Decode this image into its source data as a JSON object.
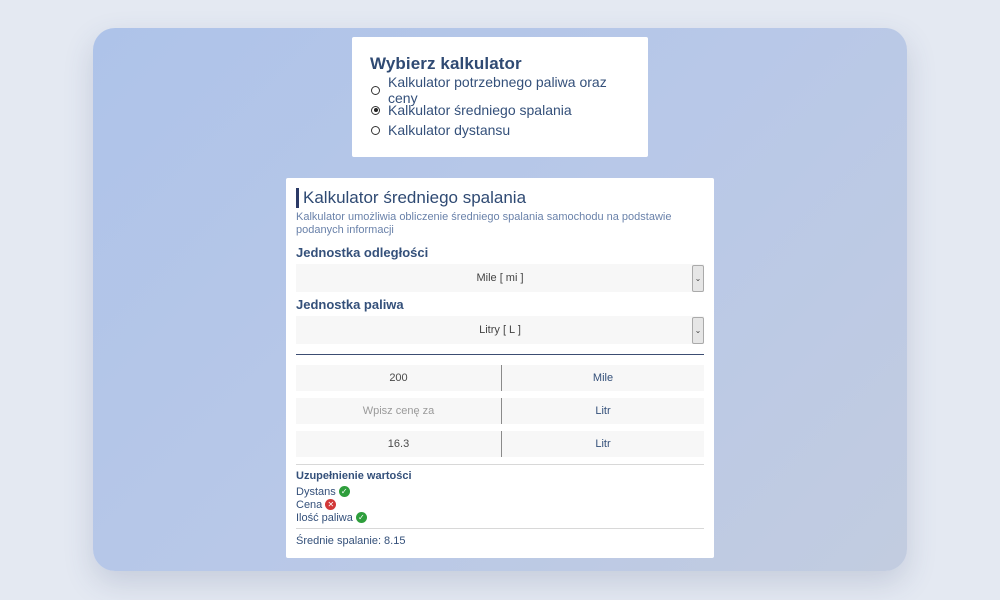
{
  "selector": {
    "title": "Wybierz kalkulator",
    "options": [
      {
        "label": "Kalkulator potrzebnego paliwa oraz ceny",
        "checked": false
      },
      {
        "label": "Kalkulator średniego spalania",
        "checked": true
      },
      {
        "label": "Kalkulator dystansu",
        "checked": false
      }
    ]
  },
  "calculator": {
    "title": "Kalkulator średniego spalania",
    "description": "Kalkulator umożliwia obliczenie średniego spalania samochodu na podstawie podanych informacji",
    "distance_unit_label": "Jednostka odległości",
    "distance_unit_value": "Mile [ mi ]",
    "fuel_unit_label": "Jednostka paliwa",
    "fuel_unit_value": "Litry [ L ]",
    "inputs": [
      {
        "value": "200",
        "placeholder": "",
        "unit": "Mile"
      },
      {
        "value": "",
        "placeholder": "Wpisz cenę za",
        "unit": "Litr"
      },
      {
        "value": "16.3",
        "placeholder": "",
        "unit": "Litr"
      }
    ],
    "status_title": "Uzupełnienie wartości",
    "status": [
      {
        "label": "Dystans",
        "ok": true
      },
      {
        "label": "Cena",
        "ok": false
      },
      {
        "label": "Ilość paliwa",
        "ok": true
      }
    ],
    "result": "Średnie spalanie: 8.15"
  },
  "icons": {
    "ok_color": "#2e9e3c",
    "bad_color": "#d23838",
    "chevron": "chevron-down-icon"
  }
}
